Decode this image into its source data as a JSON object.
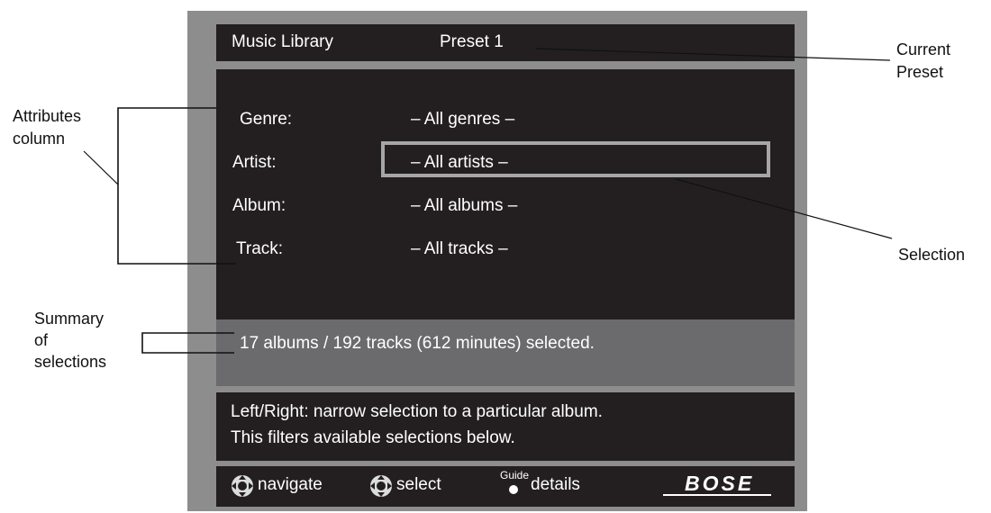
{
  "screen": {
    "header": {
      "source": "Music Library",
      "preset": "Preset 1"
    },
    "attributes": [
      {
        "label": "Genre:",
        "value": "– All genres –"
      },
      {
        "label": "Artist:",
        "value": "– All artists –"
      },
      {
        "label": "Album:",
        "value": "– All albums –"
      },
      {
        "label": "Track:",
        "value": "– All tracks –"
      }
    ],
    "summary": "17 albums / 192 tracks (612 minutes) selected.",
    "help": {
      "line1": "Left/Right: narrow selection to a particular album.",
      "line2": "This filters available selections below."
    },
    "footer": {
      "navigate": "navigate",
      "select": "select",
      "guide": "Guide",
      "details": "details",
      "brand": "BOSE"
    }
  },
  "annotations": {
    "current_preset": [
      "Current",
      "Preset"
    ],
    "attributes_column": [
      "Attributes",
      "column"
    ],
    "selection": "Selection",
    "summary_of_selections": [
      "Summary",
      "of",
      "selections"
    ]
  },
  "colors": {
    "frame": "#8d8d8d",
    "panel": "#231f20",
    "summary_band": "#6b6b6d",
    "selection_border": "#a6a6a6"
  },
  "icons": [
    "dpad-navigate-icon",
    "dpad-select-icon",
    "guide-button-icon"
  ]
}
